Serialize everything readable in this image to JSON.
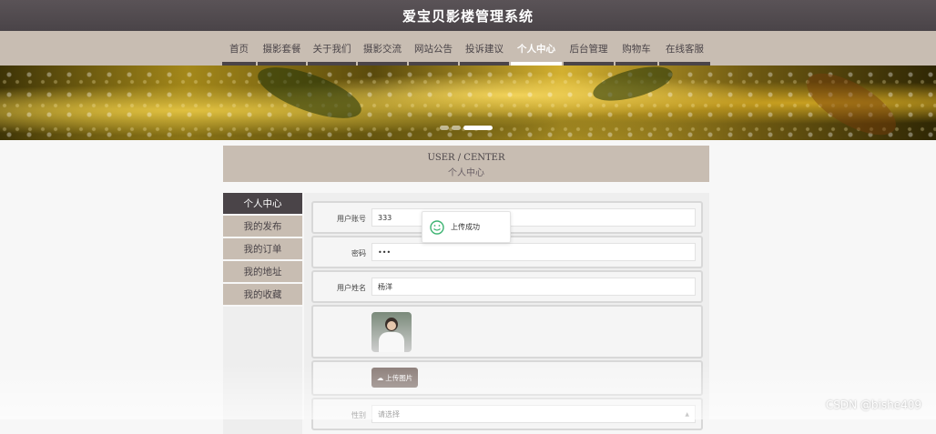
{
  "app": {
    "title": "爱宝贝影楼管理系统"
  },
  "nav": {
    "items": [
      {
        "label": "首页"
      },
      {
        "label": "摄影套餐"
      },
      {
        "label": "关于我们"
      },
      {
        "label": "摄影交流"
      },
      {
        "label": "网站公告"
      },
      {
        "label": "投诉建议"
      },
      {
        "label": "个人中心",
        "active": true
      },
      {
        "label": "后台管理"
      },
      {
        "label": "购物车"
      },
      {
        "label": "在线客服"
      }
    ]
  },
  "banner": {
    "slide_count": 3,
    "current_slide": 3
  },
  "section_header": {
    "en": "USER / CENTER",
    "cn": "个人中心"
  },
  "side_menu": {
    "items": [
      {
        "label": "个人中心",
        "active": true
      },
      {
        "label": "我的发布"
      },
      {
        "label": "我的订单"
      },
      {
        "label": "我的地址"
      },
      {
        "label": "我的收藏"
      }
    ]
  },
  "form": {
    "account": {
      "label": "用户账号",
      "value": "333"
    },
    "password": {
      "label": "密码",
      "value": "•••"
    },
    "name": {
      "label": "用户姓名",
      "value": "杨洋"
    },
    "upload_button": "上传图片",
    "gender": {
      "label": "性别",
      "value": "请选择"
    }
  },
  "toast": {
    "message": "上传成功"
  },
  "watermark": "CSDN @bishe409",
  "colors": {
    "dark": "#4a4448",
    "accent_bar": "#c8bdb2",
    "panel": "#eeeeee"
  }
}
